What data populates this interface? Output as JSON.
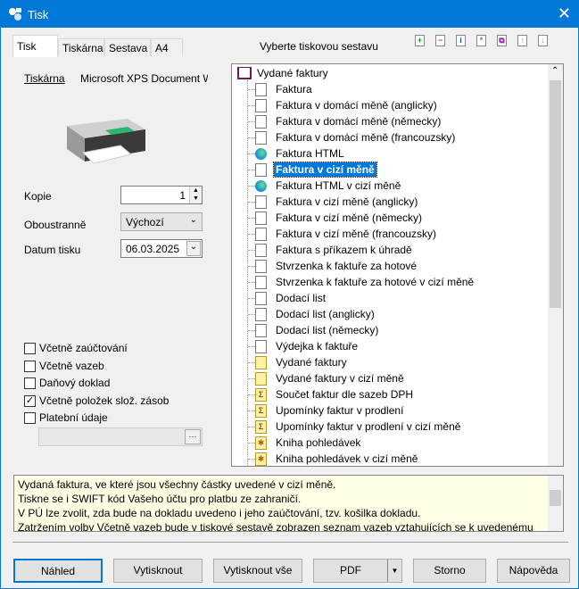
{
  "window": {
    "title": "Tisk",
    "close": "✕"
  },
  "tabs": [
    "Tisk",
    "Tiskárna",
    "Sestava",
    "A4"
  ],
  "report_header": "Vyberte tiskovou sestavu",
  "toolbar_icons": [
    {
      "name": "add-icon",
      "glyph": "+",
      "color": "#2a8a2a"
    },
    {
      "name": "remove-icon",
      "glyph": "−",
      "color": "#c8283a"
    },
    {
      "name": "info-icon",
      "glyph": "i",
      "color": "#1f4fbf"
    },
    {
      "name": "asterisk-icon",
      "glyph": "*",
      "color": "#4a7fd0"
    },
    {
      "name": "copy-icon",
      "glyph": "⧉",
      "color": "#8a1a9a"
    },
    {
      "name": "move-up-icon",
      "glyph": "↑",
      "color": "#999"
    },
    {
      "name": "move-down-icon",
      "glyph": "↓",
      "color": "#999"
    }
  ],
  "left": {
    "printer_label": "Tiskárna",
    "printer_value": "Microsoft XPS Document W",
    "copies_label": "Kopie",
    "copies_value": "1",
    "duplex_label": "Oboustranně",
    "duplex_value": "Výchozí",
    "date_label": "Datum tisku",
    "date_value": "06.03.2025",
    "checkboxes": [
      {
        "label": "Včetně zaúčtování",
        "checked": false
      },
      {
        "label": "Včetně vazeb",
        "checked": false
      },
      {
        "label": "Daňový doklad",
        "checked": false
      },
      {
        "label": "Včetně položek slož. zásob",
        "checked": true
      },
      {
        "label": "Platební údaje",
        "checked": false
      }
    ],
    "ellipsis": "···"
  },
  "tree": {
    "root": "Vydané faktury",
    "items": [
      {
        "label": "Faktura",
        "icon": "page"
      },
      {
        "label": "Faktura v domácí měně (anglicky)",
        "icon": "page"
      },
      {
        "label": "Faktura v domácí měně (německy)",
        "icon": "page"
      },
      {
        "label": "Faktura v domácí měně (francouzsky)",
        "icon": "page"
      },
      {
        "label": "Faktura HTML",
        "icon": "edge"
      },
      {
        "label": "Faktura v cizí měně",
        "icon": "page",
        "selected": true
      },
      {
        "label": "Faktura HTML v cizí měně",
        "icon": "edge"
      },
      {
        "label": "Faktura v cizí měně (anglicky)",
        "icon": "page"
      },
      {
        "label": "Faktura v cizí měně (německy)",
        "icon": "page"
      },
      {
        "label": "Faktura v cizí měně (francouzsky)",
        "icon": "page"
      },
      {
        "label": "Faktura s příkazem k úhradě",
        "icon": "page"
      },
      {
        "label": "Stvrzenka k faktuře za hotové",
        "icon": "page"
      },
      {
        "label": "Stvrzenka k faktuře za hotové v cizí měně",
        "icon": "page"
      },
      {
        "label": "Dodací list",
        "icon": "page"
      },
      {
        "label": "Dodací list (anglicky)",
        "icon": "page"
      },
      {
        "label": "Dodací list (německy)",
        "icon": "page"
      },
      {
        "label": "Výdejka k faktuře",
        "icon": "page"
      },
      {
        "label": "Vydané faktury",
        "icon": "yellow"
      },
      {
        "label": "Vydané faktury v cizí měně",
        "icon": "yellow"
      },
      {
        "label": "Součet faktur dle sazeb DPH",
        "icon": "sigma"
      },
      {
        "label": "Upomínky faktur v prodlení",
        "icon": "sigma"
      },
      {
        "label": "Upomínky faktur v prodlení v cizí měně",
        "icon": "sigma"
      },
      {
        "label": "Kniha pohledávek",
        "icon": "star"
      },
      {
        "label": "Kniha pohledávek v cizí měně",
        "icon": "star"
      }
    ]
  },
  "description": [
    "Vydaná faktura, ve které jsou všechny částky uvedené v cizí měně.",
    "Tiskne se i SWIFT kód Vašeho účtu pro platbu ze zahraničí.",
    "V PÚ lze zvolit, zda bude na dokladu uvedeno i jeho zaúčtování, tzv. košilka dokladu.",
    "Zatržením volby Včetně vazeb bude v tiskové sestavě zobrazen seznam vazeb vztahujících se k uvedenému"
  ],
  "buttons": {
    "preview": "Náhled",
    "print": "Vytisknout",
    "print_all": "Vytisknout vše",
    "pdf": "PDF",
    "cancel": "Storno",
    "help": "Nápověda"
  }
}
